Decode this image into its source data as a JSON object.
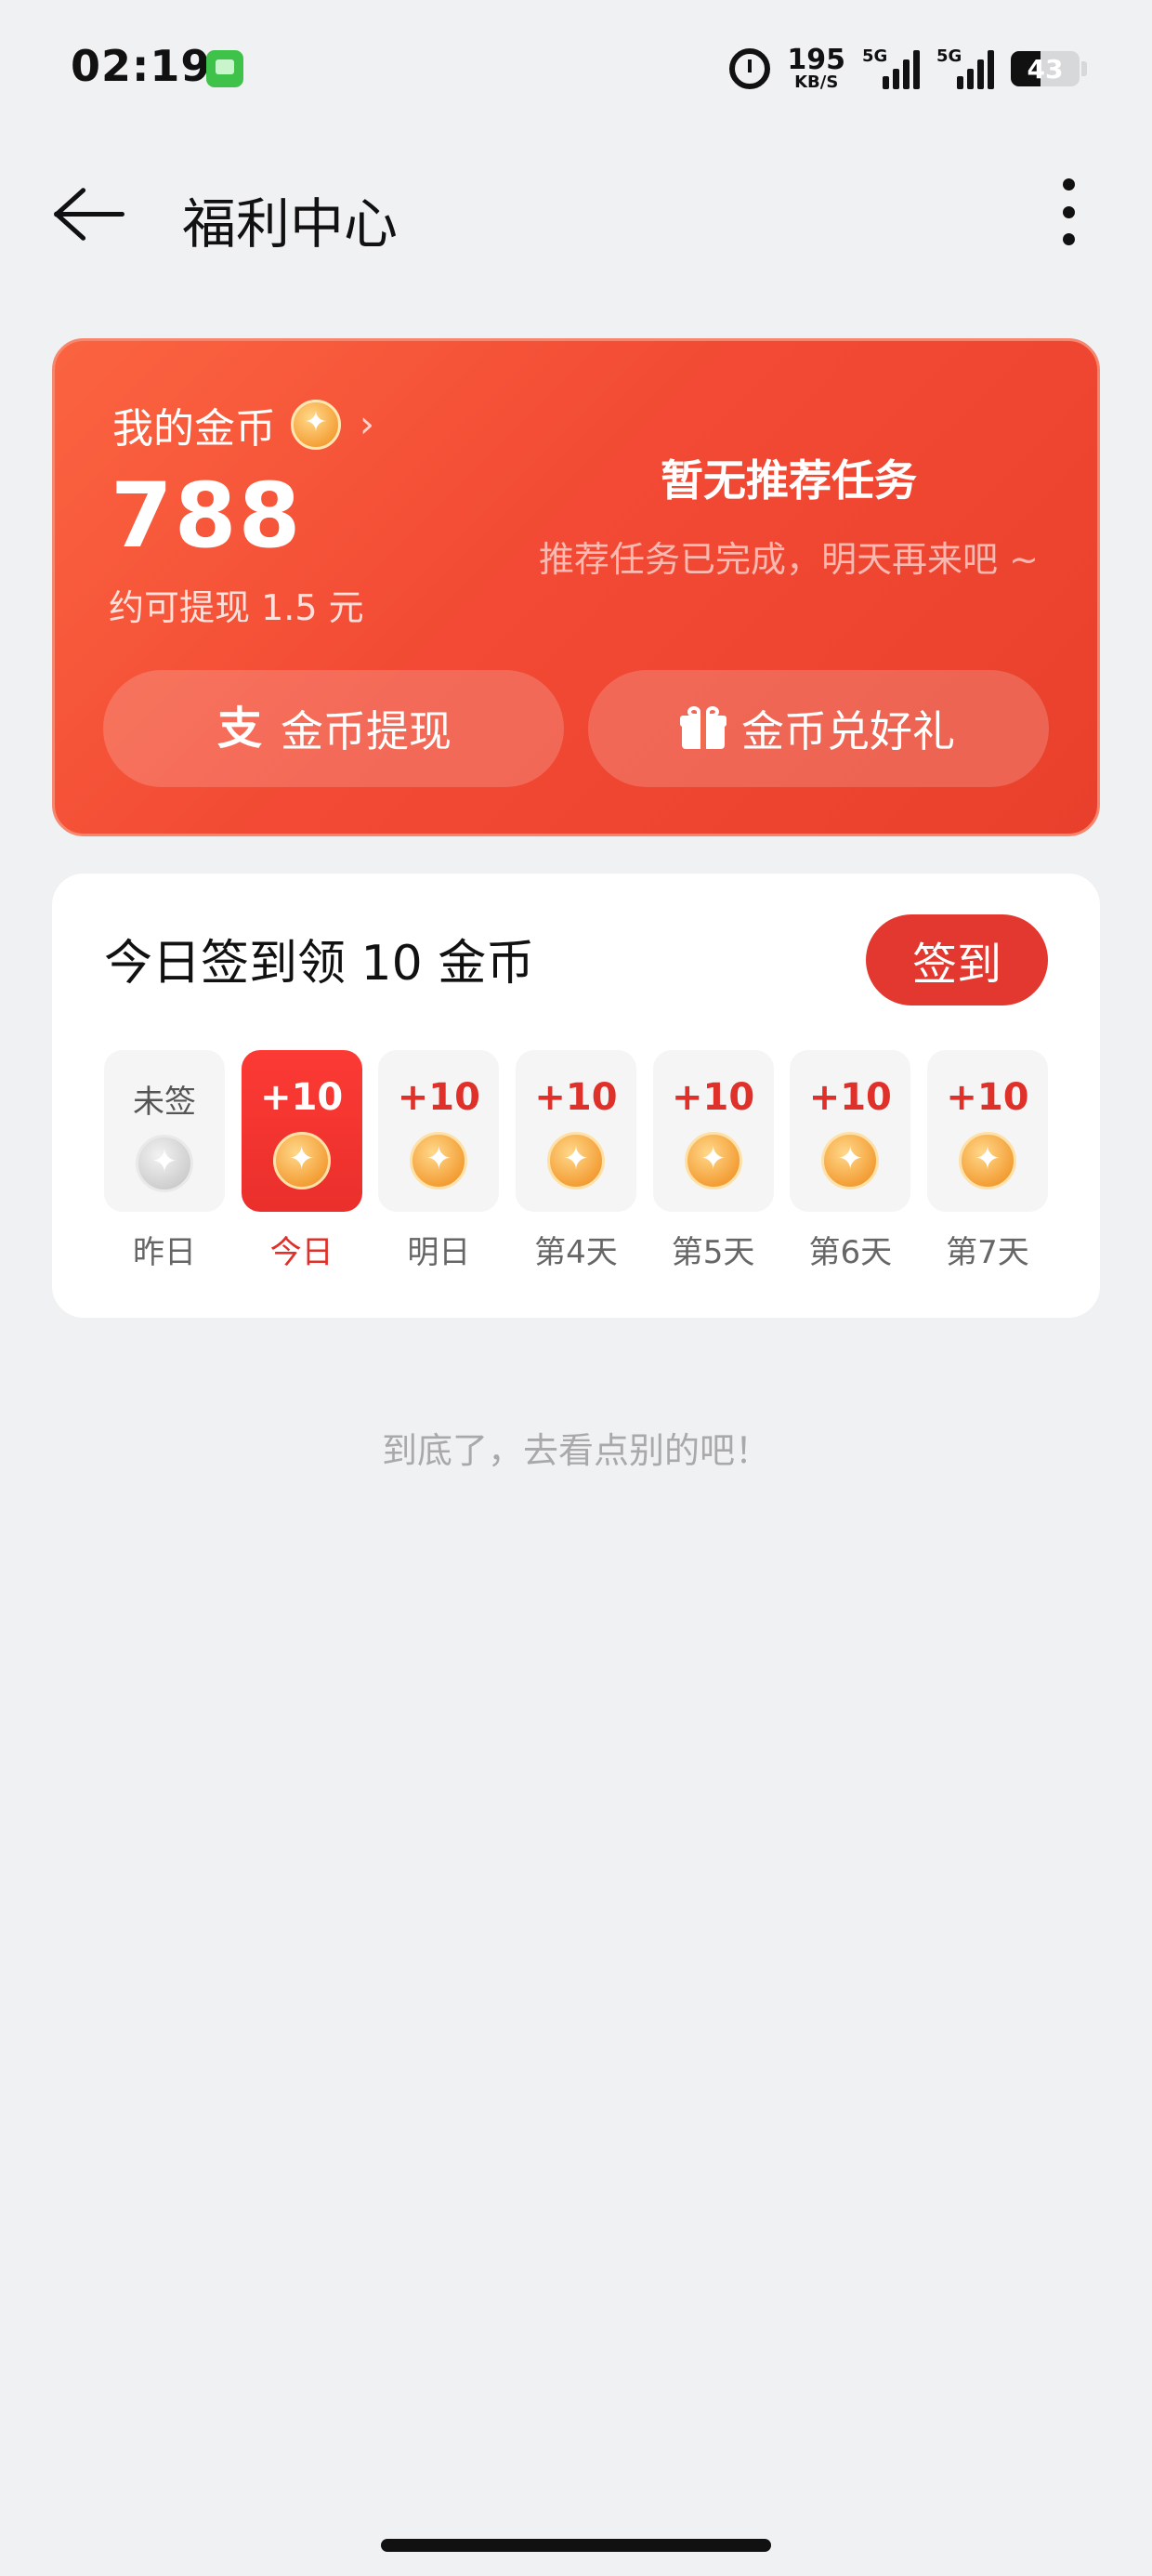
{
  "status_bar": {
    "time": "02:19",
    "net_speed_value": "195",
    "net_speed_unit": "KB/S",
    "sim1_tag": "5G",
    "sim2_tag": "5G",
    "battery_text": "43",
    "battery_level": 0.43
  },
  "header": {
    "title": "福利中心"
  },
  "coin_card": {
    "label": "我的金币",
    "amount": "788",
    "withdraw_hint": "约可提现 1.5 元",
    "task_title": "暂无推荐任务",
    "task_subtitle": "推荐任务已完成，明天再来吧 ~",
    "withdraw_button": "金币提现",
    "exchange_button": "金币兑好礼",
    "colors": {
      "gradient_start": "#fb6440",
      "gradient_end": "#e8402b"
    }
  },
  "checkin": {
    "title": "今日签到领 10 金币",
    "button": "签到",
    "days": [
      {
        "reward": "未签",
        "label": "昨日",
        "state": "missed"
      },
      {
        "reward": "+10",
        "label": "今日",
        "state": "today"
      },
      {
        "reward": "+10",
        "label": "明日",
        "state": "upcoming"
      },
      {
        "reward": "+10",
        "label": "第4天",
        "state": "upcoming"
      },
      {
        "reward": "+10",
        "label": "第5天",
        "state": "upcoming"
      },
      {
        "reward": "+10",
        "label": "第6天",
        "state": "upcoming"
      },
      {
        "reward": "+10",
        "label": "第7天",
        "state": "upcoming"
      }
    ],
    "colors": {
      "accent": "#e2382f"
    }
  },
  "footer": {
    "end_text": "到底了，去看点别的吧！"
  }
}
